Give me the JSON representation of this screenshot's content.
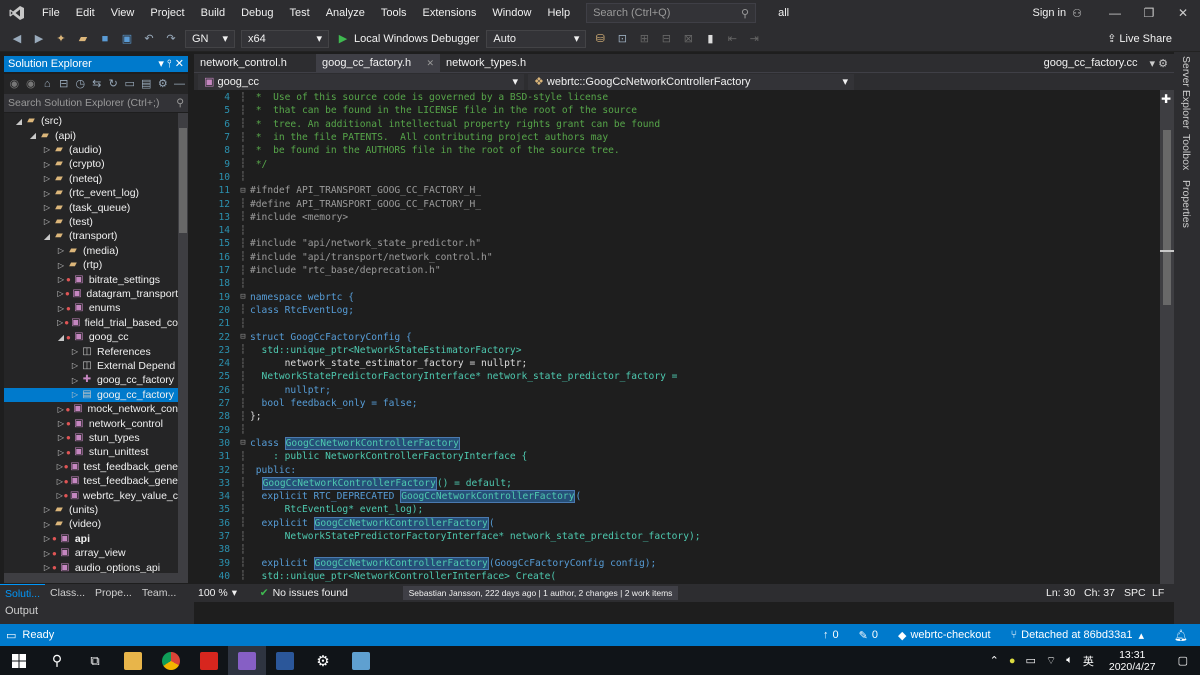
{
  "menu": [
    "File",
    "Edit",
    "View",
    "Project",
    "Build",
    "Debug",
    "Test",
    "Analyze",
    "Tools",
    "Extensions",
    "Window",
    "Help"
  ],
  "search": {
    "placeholder": "Search (Ctrl+Q)"
  },
  "solution_name": "all",
  "signin": "Sign in",
  "toolbar": {
    "config": "GN",
    "platform": "x64",
    "debugger": "Local Windows Debugger",
    "debugger_mode": "Auto",
    "live_share": "Live Share"
  },
  "solution_explorer": {
    "title": "Solution Explorer",
    "search_placeholder": "Search Solution Explorer (Ctrl+;)",
    "tree": [
      {
        "indent": 1,
        "label": "(src)",
        "kind": "folder",
        "open": true
      },
      {
        "indent": 2,
        "label": "(api)",
        "kind": "folder",
        "open": true
      },
      {
        "indent": 3,
        "label": "(audio)",
        "kind": "folder"
      },
      {
        "indent": 3,
        "label": "(crypto)",
        "kind": "folder"
      },
      {
        "indent": 3,
        "label": "(neteq)",
        "kind": "folder"
      },
      {
        "indent": 3,
        "label": "(rtc_event_log)",
        "kind": "folder"
      },
      {
        "indent": 3,
        "label": "(task_queue)",
        "kind": "folder"
      },
      {
        "indent": 3,
        "label": "(test)",
        "kind": "folder"
      },
      {
        "indent": 3,
        "label": "(transport)",
        "kind": "folder",
        "open": true
      },
      {
        "indent": 4,
        "label": "(media)",
        "kind": "folder"
      },
      {
        "indent": 4,
        "label": "(rtp)",
        "kind": "folder"
      },
      {
        "indent": 4,
        "label": "bitrate_settings",
        "kind": "proj"
      },
      {
        "indent": 4,
        "label": "datagram_transport",
        "kind": "proj"
      },
      {
        "indent": 4,
        "label": "enums",
        "kind": "proj"
      },
      {
        "indent": 4,
        "label": "field_trial_based_co",
        "kind": "proj"
      },
      {
        "indent": 4,
        "label": "goog_cc",
        "kind": "proj",
        "open": true
      },
      {
        "indent": 5,
        "label": "References",
        "kind": "ref"
      },
      {
        "indent": 5,
        "label": "External Depend",
        "kind": "ref"
      },
      {
        "indent": 5,
        "label": "goog_cc_factory",
        "kind": "cc"
      },
      {
        "indent": 5,
        "label": "goog_cc_factory",
        "kind": "h",
        "selected": true
      },
      {
        "indent": 4,
        "label": "mock_network_con",
        "kind": "proj"
      },
      {
        "indent": 4,
        "label": "network_control",
        "kind": "proj"
      },
      {
        "indent": 4,
        "label": "stun_types",
        "kind": "proj"
      },
      {
        "indent": 4,
        "label": "stun_unittest",
        "kind": "proj"
      },
      {
        "indent": 4,
        "label": "test_feedback_gene",
        "kind": "proj"
      },
      {
        "indent": 4,
        "label": "test_feedback_gene",
        "kind": "proj"
      },
      {
        "indent": 4,
        "label": "webrtc_key_value_c",
        "kind": "proj"
      },
      {
        "indent": 3,
        "label": "(units)",
        "kind": "folder"
      },
      {
        "indent": 3,
        "label": "(video)",
        "kind": "folder"
      },
      {
        "indent": 3,
        "label": "api",
        "kind": "proj",
        "bold": true
      },
      {
        "indent": 3,
        "label": "array_view",
        "kind": "proj"
      },
      {
        "indent": 3,
        "label": "audio_options_api",
        "kind": "proj"
      }
    ],
    "bottom_tabs": [
      "Soluti...",
      "Class...",
      "Prope...",
      "Team..."
    ]
  },
  "output_label": "Output",
  "doc_tabs": [
    {
      "label": "network_control.h",
      "active": false
    },
    {
      "label": "goog_cc_factory.h",
      "active": true
    },
    {
      "label": "network_types.h",
      "active": false
    }
  ],
  "doc_tab_right": "goog_cc_factory.cc",
  "nav": {
    "project": "goog_cc",
    "scope": "webrtc::GoogCcNetworkControllerFactory"
  },
  "code": [
    {
      "n": "4",
      "t": " *  Use of this source code is governed by a BSD-style license",
      "c": "comment"
    },
    {
      "n": "5",
      "t": " *  that can be found in the LICENSE file in the root of the source",
      "c": "comment"
    },
    {
      "n": "6",
      "t": " *  tree. An additional intellectual property rights grant can be found",
      "c": "comment"
    },
    {
      "n": "7",
      "t": " *  in the file PATENTS.  All contributing project authors may",
      "c": "comment"
    },
    {
      "n": "8",
      "t": " *  be found in the AUTHORS file in the root of the source tree.",
      "c": "comment"
    },
    {
      "n": "9",
      "t": " */",
      "c": "comment"
    },
    {
      "n": "10",
      "t": "",
      "c": "plain"
    },
    {
      "n": "11",
      "t": "#ifndef API_TRANSPORT_GOOG_CC_FACTORY_H_",
      "c": "pre"
    },
    {
      "n": "12",
      "t": "#define API_TRANSPORT_GOOG_CC_FACTORY_H_",
      "c": "pre"
    },
    {
      "n": "13",
      "t": "#include <memory>",
      "c": "pre"
    },
    {
      "n": "14",
      "t": "",
      "c": "plain"
    },
    {
      "n": "15",
      "t": "#include \"api/network_state_predictor.h\"",
      "c": "pre"
    },
    {
      "n": "16",
      "t": "#include \"api/transport/network_control.h\"",
      "c": "pre"
    },
    {
      "n": "17",
      "t": "#include \"rtc_base/deprecation.h\"",
      "c": "pre"
    },
    {
      "n": "18",
      "t": "",
      "c": "plain"
    },
    {
      "n": "19",
      "t": "namespace webrtc {",
      "c": "kw"
    },
    {
      "n": "20",
      "t": "class RtcEventLog;",
      "c": "kw"
    },
    {
      "n": "21",
      "t": "",
      "c": "plain"
    },
    {
      "n": "22",
      "t": "struct GoogCcFactoryConfig {",
      "c": "kw"
    },
    {
      "n": "23",
      "t": "  std::unique_ptr<NetworkStateEstimatorFactory>",
      "c": "type"
    },
    {
      "n": "24",
      "t": "      network_state_estimator_factory = nullptr;",
      "c": "plain"
    },
    {
      "n": "25",
      "t": "  NetworkStatePredictorFactoryInterface* network_state_predictor_factory =",
      "c": "type"
    },
    {
      "n": "26",
      "t": "      nullptr;",
      "c": "kw"
    },
    {
      "n": "27",
      "t": "  bool feedback_only = false;",
      "c": "kw"
    },
    {
      "n": "28",
      "t": "};",
      "c": "plain"
    },
    {
      "n": "29",
      "t": "",
      "c": "plain"
    },
    {
      "n": "30",
      "t": "class GoogCcNetworkControllerFactory",
      "c": "kw"
    },
    {
      "n": "31",
      "t": "    : public NetworkControllerFactoryInterface {",
      "c": "type"
    },
    {
      "n": "32",
      "t": " public:",
      "c": "kw"
    },
    {
      "n": "33",
      "t": "  GoogCcNetworkControllerFactory() = default;",
      "c": "type"
    },
    {
      "n": "34",
      "t": "  explicit RTC_DEPRECATED GoogCcNetworkControllerFactory(",
      "c": "kw"
    },
    {
      "n": "35",
      "t": "      RtcEventLog* event_log);",
      "c": "type"
    },
    {
      "n": "36",
      "t": "  explicit GoogCcNetworkControllerFactory(",
      "c": "kw"
    },
    {
      "n": "37",
      "t": "      NetworkStatePredictorFactoryInterface* network_state_predictor_factory);",
      "c": "type"
    },
    {
      "n": "38",
      "t": "",
      "c": "plain"
    },
    {
      "n": "39",
      "t": "  explicit GoogCcNetworkControllerFactory(GoogCcFactoryConfig config);",
      "c": "kw"
    },
    {
      "n": "40",
      "t": "  std::unique_ptr<NetworkControllerInterface> Create(",
      "c": "type"
    }
  ],
  "editor_status": {
    "zoom": "100 %",
    "issues": "No issues found",
    "blame": "Sebastian Jansson, 222 days ago | 1 author, 2 changes | 2 work items",
    "ln": "Ln: 30",
    "ch": "Ch: 37",
    "spc": "SPC",
    "lf": "LF"
  },
  "status": {
    "ready": "Ready",
    "up": "0",
    "pencil": "0",
    "repo": "webrtc-checkout",
    "branch": "Detached at 86bd33a1"
  },
  "clock": {
    "time": "13:31",
    "date": "2020/4/27"
  },
  "ime": "英",
  "right_rail": [
    "Server Explorer",
    "Toolbox",
    "Properties"
  ],
  "colors": {
    "accent": "#007acc",
    "comment": "#57a64a",
    "keyword": "#569cd6",
    "type": "#4ec9b0",
    "string": "#d69d85",
    "preproc": "#9b9b9b",
    "macro": "#bd63c5"
  }
}
